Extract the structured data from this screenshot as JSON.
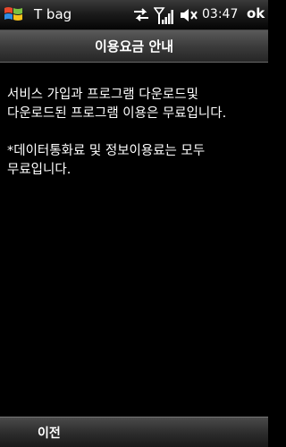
{
  "status_bar": {
    "app_title": "T bag",
    "time": "03:47",
    "ok_label": "ok",
    "icons": [
      "windows-start-icon",
      "connectivity-icon",
      "signal-icon",
      "volume-icon"
    ]
  },
  "header": {
    "title": "이용요금 안내"
  },
  "content": {
    "paragraphs": [
      "서비스 가입과 프로그램 다운로드및 다운로드된 프로그램 이용은 무료입니다.",
      "*데이터통화료 및 정보이용료는 모두 무료입니다."
    ]
  },
  "softkeys": {
    "left_label": "이전"
  }
}
